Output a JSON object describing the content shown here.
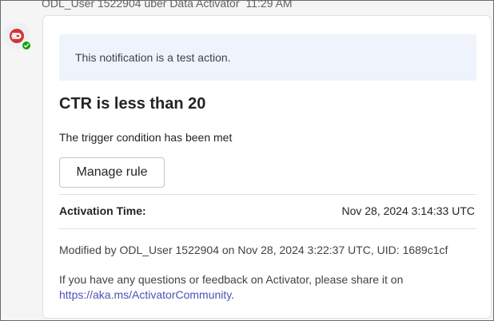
{
  "message": {
    "sender": "ODL_User 1522904 über Data Activator",
    "time": "11:29 AM"
  },
  "avatar": {
    "icon": "activator-logo-icon",
    "status": "available",
    "status_color": "#13a10e",
    "brand_color": "#d13438"
  },
  "card": {
    "banner_text": "This notification is a test action.",
    "title": "CTR is less than 20",
    "subtitle": "The trigger condition has been met",
    "manage_button_label": "Manage rule",
    "activation_label": "Activation Time:",
    "activation_value": "Nov 28, 2024 3:14:33 UTC",
    "modified_text": "Modified by ODL_User 1522904 on Nov 28, 2024 3:22:37 UTC, UID: 1689c1cf",
    "feedback_text": "If you have any questions or feedback on Activator, please share it on",
    "feedback_link": "https://aka.ms/ActivatorCommunity",
    "feedback_suffix": "."
  }
}
